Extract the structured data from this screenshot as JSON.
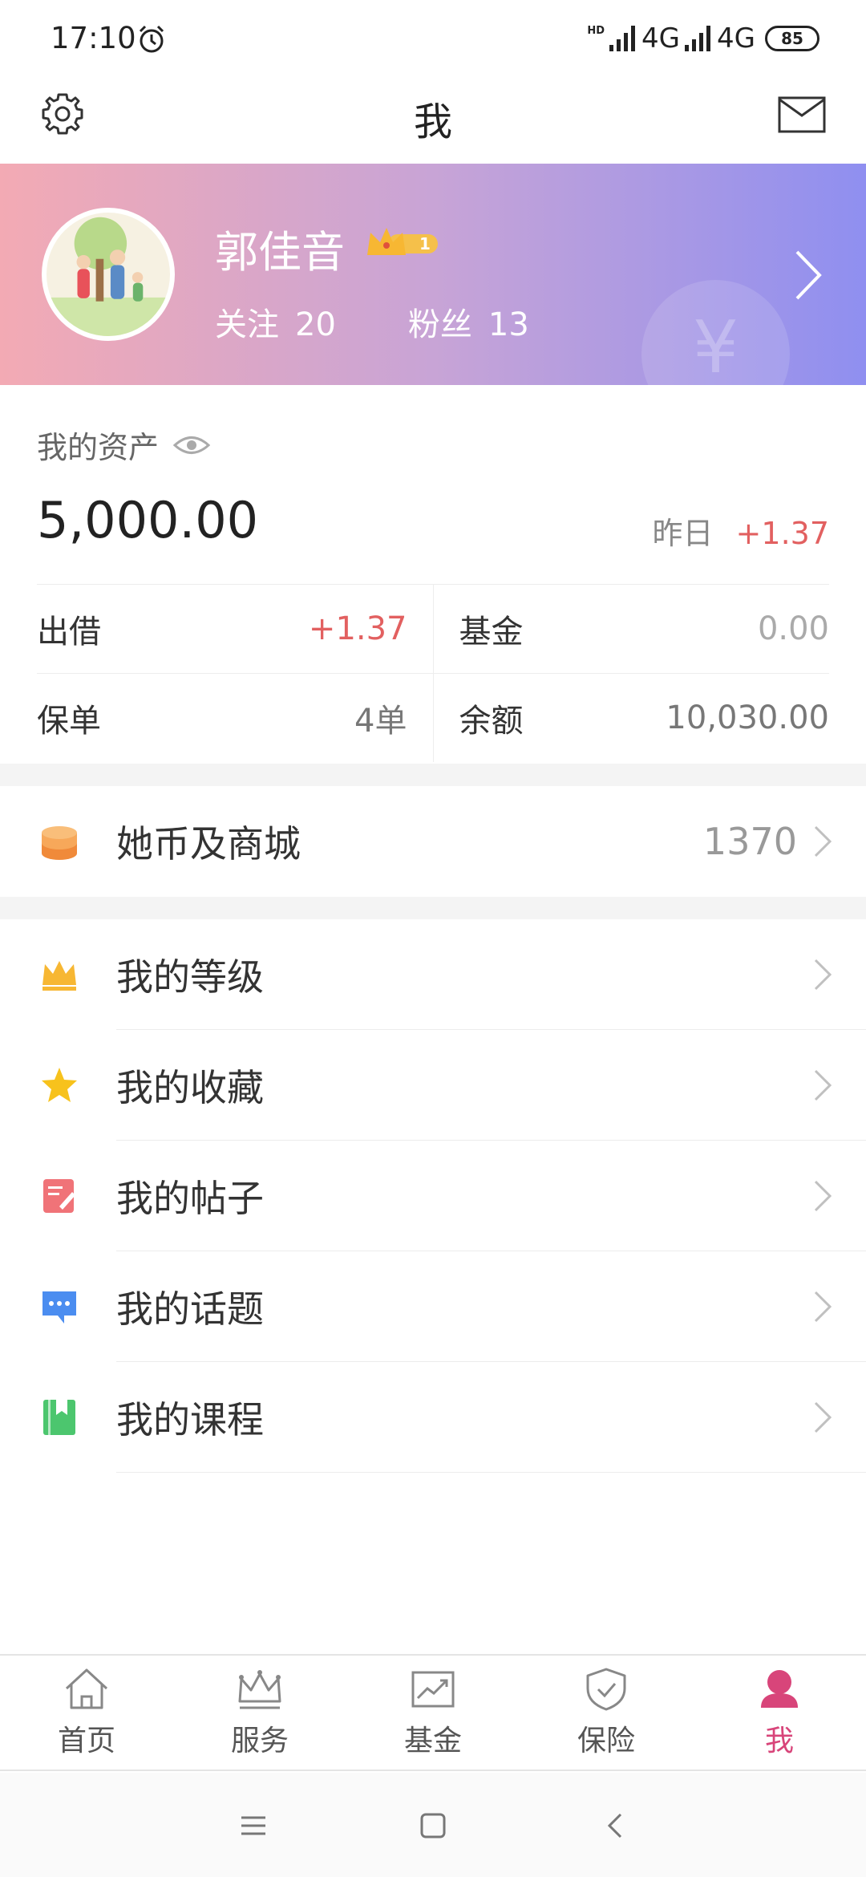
{
  "status_bar": {
    "time": "17:10",
    "hd": "HD",
    "network1": "4G",
    "network2": "4G",
    "battery": "85"
  },
  "header": {
    "title": "我"
  },
  "profile": {
    "name": "郭佳音",
    "level": "1",
    "follow_label": "关注",
    "follow_count": "20",
    "fans_label": "粉丝",
    "fans_count": "13",
    "watermark": "¥"
  },
  "assets": {
    "label": "我的资产",
    "total": "5,000.00",
    "yesterday_label": "昨日",
    "yesterday_value": "+1.37",
    "grid": [
      {
        "key": "出借",
        "value": "+1.37"
      },
      {
        "key": "基金",
        "value": "0.00"
      },
      {
        "key": "保单",
        "value": "4单"
      },
      {
        "key": "余额",
        "value": "10,030.00"
      }
    ]
  },
  "coin": {
    "label": "她币及商城",
    "value": "1370"
  },
  "menu": [
    {
      "label": "我的等级",
      "icon": "crown-icon"
    },
    {
      "label": "我的收藏",
      "icon": "star-icon"
    },
    {
      "label": "我的帖子",
      "icon": "post-icon"
    },
    {
      "label": "我的话题",
      "icon": "topic-icon"
    },
    {
      "label": "我的课程",
      "icon": "course-icon"
    }
  ],
  "bottom_nav": [
    {
      "label": "首页",
      "icon": "home-icon"
    },
    {
      "label": "服务",
      "icon": "crown-icon"
    },
    {
      "label": "基金",
      "icon": "chart-icon"
    },
    {
      "label": "保险",
      "icon": "shield-icon"
    },
    {
      "label": "我",
      "icon": "person-icon",
      "active": true
    }
  ],
  "colors": {
    "accent": "#d8457a",
    "positive": "#e26060",
    "banner_start": "#f3aab4",
    "banner_end": "#8f8ff0"
  }
}
